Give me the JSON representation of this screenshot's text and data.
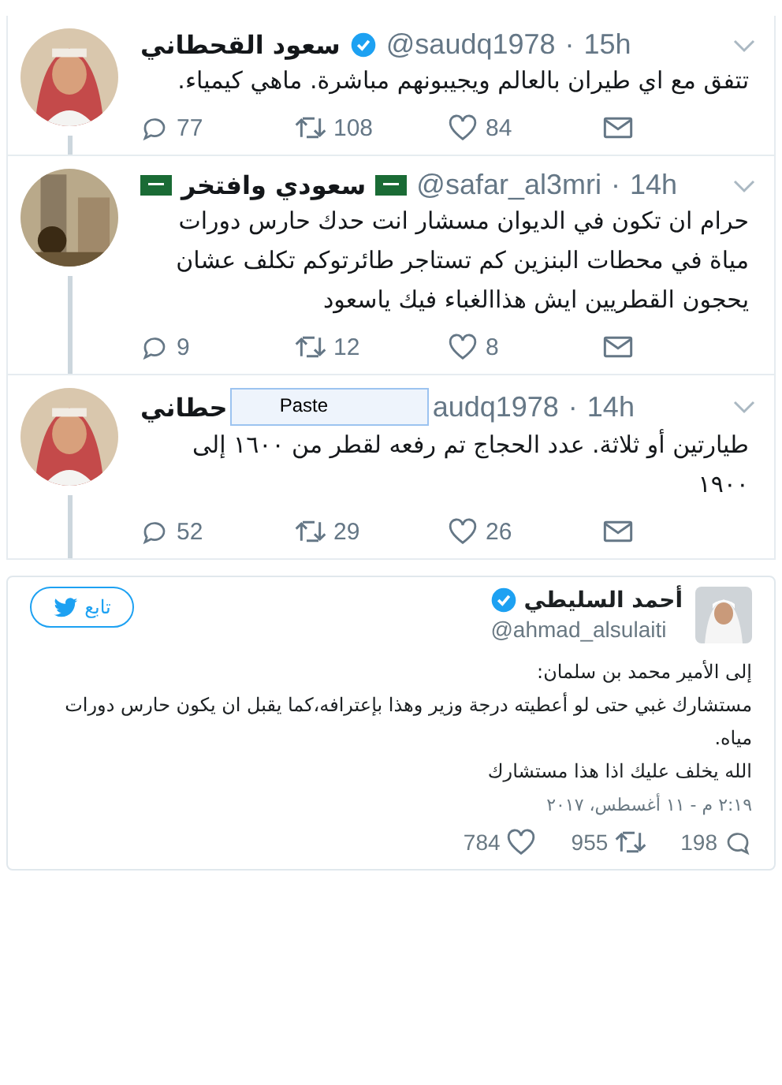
{
  "thread": [
    {
      "name": "سعود القحطاني",
      "verified": true,
      "flags": false,
      "handle": "@saudq1978",
      "sep": "·",
      "time": "15h",
      "body": "تتفق مع اي طيران بالعالم ويجيبونهم مباشرة. ماهي كيمياء.",
      "replies": "77",
      "retweets": "108",
      "likes": "84"
    },
    {
      "name": "سعودي وافتخر",
      "verified": false,
      "flags": true,
      "handle": "@safar_al3mri",
      "sep": "·",
      "time": "14h",
      "body": "حرام ان تكون في الديوان  مسشار انت حدك حارس دورات مياة في محطات البنزين كم تستاجر طائرتوكم تكلف عشان يحجون القطريين ايش هذاالغباء فيك ياسعود",
      "replies": "9",
      "retweets": "12",
      "likes": "8"
    },
    {
      "name": "حطاني",
      "verified": false,
      "flags": false,
      "handle": "audq1978",
      "sep": "·",
      "time": "14h",
      "body": "طيارتين أو ثلاثة.  عدد الحجاج تم رفعه لقطر من ١٦٠٠ إلى ١٩٠٠",
      "replies": "52",
      "retweets": "29",
      "likes": "26",
      "popup": "Paste"
    }
  ],
  "embed": {
    "name": "أحمد السليطي",
    "verified": true,
    "handle": "@ahmad_alsulaiti",
    "follow": "تابع",
    "lines": [
      "إلى الأمير محمد بن سلمان:",
      "مستشارك غبي حتى لو أعطيته درجة وزير وهذا بإعترافه،كما يقبل ان يكون حارس دورات مياه.",
      "الله يخلف عليك اذا هذا مستشارك"
    ],
    "date": "٢:١٩ م - ١١ أغسطس، ٢٠١٧",
    "likes": "784",
    "retweets": "955",
    "replies": "198"
  }
}
